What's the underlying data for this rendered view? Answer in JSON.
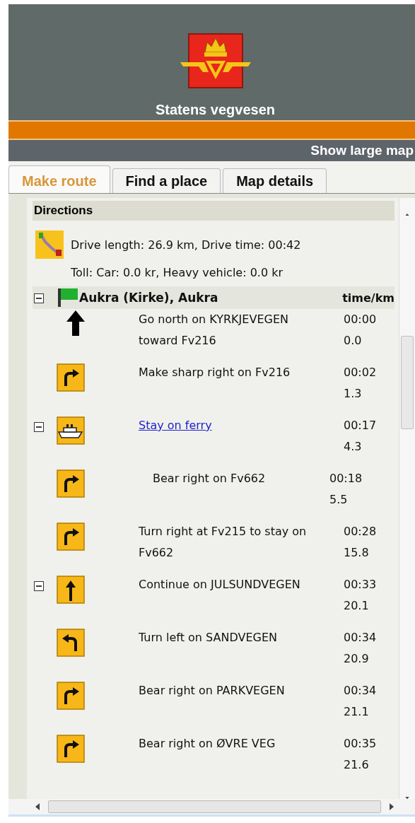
{
  "header": {
    "title": "Statens vegvesen"
  },
  "nav_bar": {
    "link": "Show large map"
  },
  "tabs": [
    {
      "label": "Make route",
      "selected": true
    },
    {
      "label": "Find a place",
      "selected": false
    },
    {
      "label": "Map details",
      "selected": false
    }
  ],
  "directions": {
    "title": "Directions",
    "summary": "Drive length: 26.9 km, Drive time: 00:42",
    "toll": "Toll: Car: 0.0 kr, Heavy vehicle: 0.0 kr",
    "start": {
      "name": "Aukra (Kirke), Aukra",
      "column_label": "time/km",
      "expanded": true
    },
    "steps": [
      {
        "kind": "north",
        "text": "Go north on KYRKJEVEGEN toward Fv216",
        "time": "00:00",
        "km": "0.0"
      },
      {
        "kind": "right",
        "text": "Make sharp right on Fv216",
        "time": "00:02",
        "km": "1.3"
      },
      {
        "kind": "ferry",
        "text": "Stay on ferry",
        "link": true,
        "expanded": true,
        "time": "00:17",
        "km": "4.3",
        "children": [
          {
            "kind": "right",
            "text": "Bear right on Fv662",
            "time": "00:18",
            "km": "5.5"
          }
        ]
      },
      {
        "kind": "right",
        "text": "Turn right at Fv215 to stay on Fv662",
        "time": "00:28",
        "km": "15.8"
      },
      {
        "kind": "straight",
        "text": "Continue on JULSUNDVEGEN",
        "expanded": true,
        "time": "00:33",
        "km": "20.1"
      },
      {
        "kind": "left",
        "text": "Turn left on SANDVEGEN",
        "time": "00:34",
        "km": "20.9"
      },
      {
        "kind": "right",
        "text": "Bear right on PARKVEGEN",
        "time": "00:34",
        "km": "21.1"
      },
      {
        "kind": "right",
        "text": "Bear right on ØVRE VEG",
        "time": "00:35",
        "km": "21.6"
      }
    ]
  }
}
